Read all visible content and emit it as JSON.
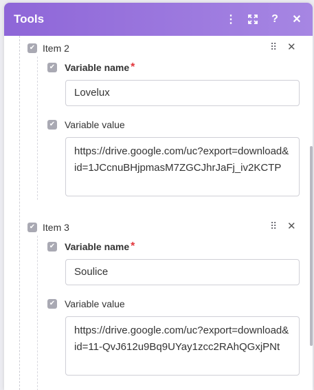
{
  "panel": {
    "title": "Tools",
    "icons": [
      "kebab-menu-icon",
      "expand-icon",
      "help-icon",
      "close-icon"
    ]
  },
  "items": [
    {
      "label": "Item 2",
      "name_label": "Variable name",
      "required_mark": "*",
      "name_value": "Lovelux",
      "value_label": "Variable value",
      "value_text": "https://drive.google.com/uc?export=download&id=1JCcnuBHjpmasM7ZGCJhrJaFj_iv2KCTP"
    },
    {
      "label": "Item 3",
      "name_label": "Variable name",
      "required_mark": "*",
      "name_value": "Soulice",
      "value_label": "Variable value",
      "value_text": "https://drive.google.com/uc?export=download&id=11-QvJ612u9Bq9UYay1zcc2RAhQGxjPNt"
    }
  ],
  "colors": {
    "header_start": "#8e66d8",
    "header_end": "#a686e3",
    "required": "#e2373c"
  }
}
